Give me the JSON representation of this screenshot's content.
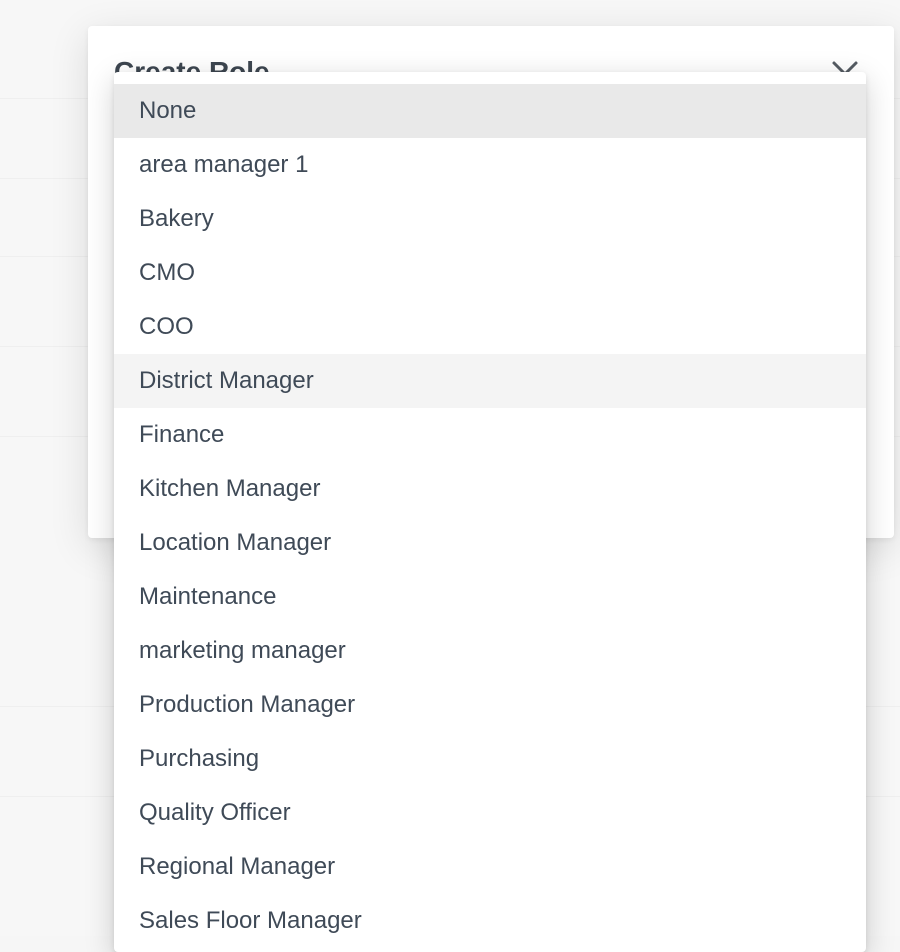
{
  "modal": {
    "title": "Create Role",
    "close_icon": "close-icon"
  },
  "dropdown": {
    "selected_index": 0,
    "hovered_index": 5,
    "options": [
      "None",
      "area manager 1",
      "Bakery",
      "CMO",
      "COO",
      "District Manager",
      "Finance",
      "Kitchen Manager",
      "Location Manager",
      "Maintenance",
      "marketing manager",
      "Production Manager",
      "Purchasing",
      "Quality Officer",
      "Regional Manager",
      "Sales Floor Manager"
    ]
  },
  "colors": {
    "selected_bg": "#e9e9e9",
    "hover_bg": "#f4f4f4",
    "text": "#3f4a57"
  }
}
